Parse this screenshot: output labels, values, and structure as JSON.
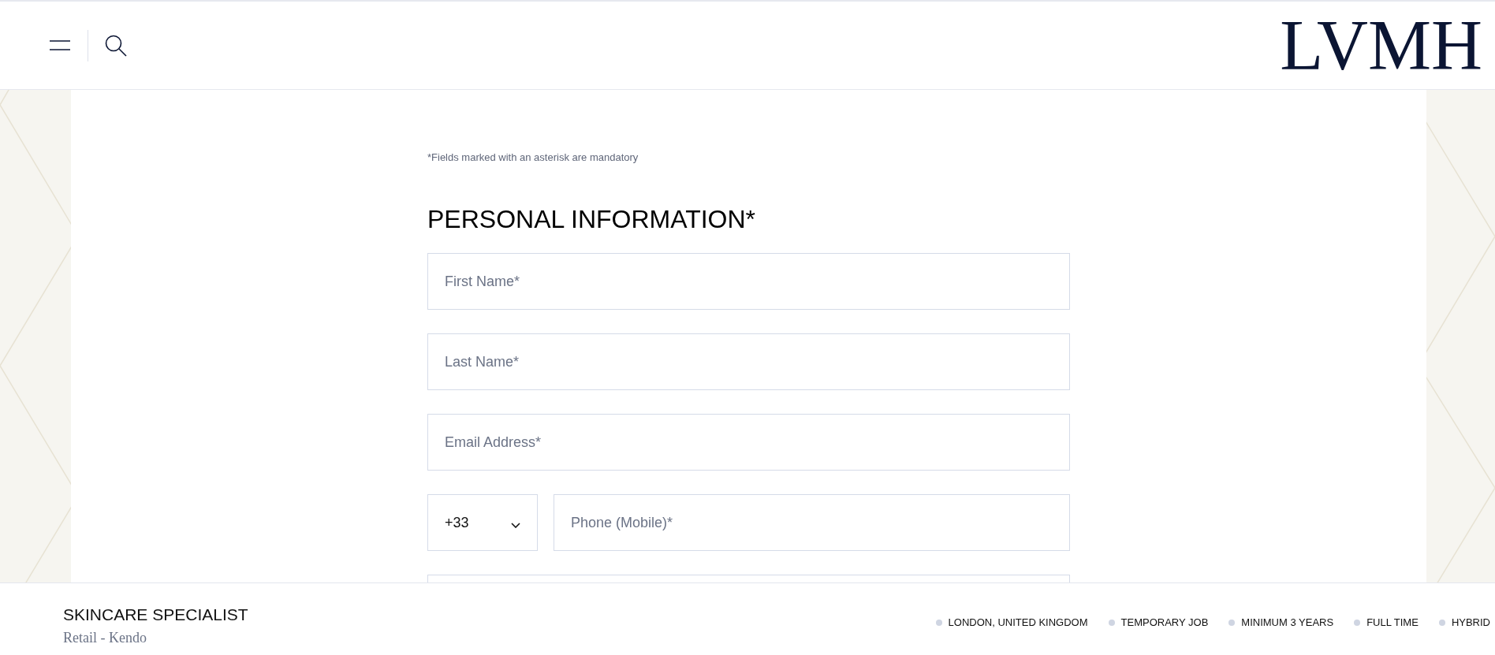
{
  "header": {
    "logo": "LVMH"
  },
  "form": {
    "notice": "*Fields marked with an asterisk are mandatory",
    "heading": "PERSONAL INFORMATION*",
    "fields": [
      {
        "kind": "text",
        "placeholder": "First Name*"
      },
      {
        "kind": "text",
        "placeholder": "Last Name*"
      },
      {
        "kind": "text",
        "placeholder": "Email Address*"
      },
      {
        "kind": "phone",
        "country_code": "+33",
        "placeholder": "Phone (Mobile)*"
      }
    ]
  },
  "footer": {
    "job_title": "SKINCARE SPECIALIST",
    "subtitle": "Retail - Kendo",
    "tags": [
      "LONDON, UNITED KINGDOM",
      "TEMPORARY JOB",
      "MINIMUM 3 YEARS",
      "FULL TIME",
      "HYBRID"
    ]
  }
}
